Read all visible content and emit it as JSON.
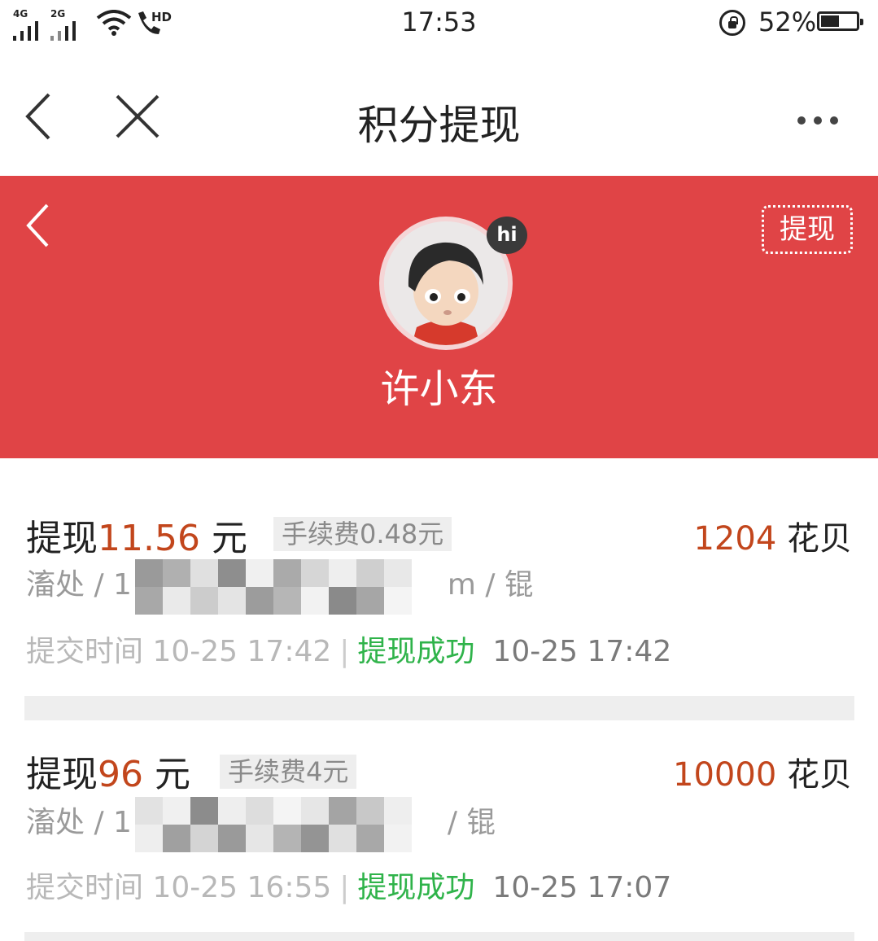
{
  "status_bar": {
    "network_1": "4G",
    "network_2": "2G",
    "time": "17:53",
    "battery_percent": "52%",
    "battery_level": 0.52,
    "icons": [
      "signal-icon",
      "wifi-icon",
      "hd-call-icon",
      "rotation-lock-icon",
      "battery-icon"
    ]
  },
  "nav": {
    "title": "积分提现"
  },
  "profile": {
    "username": "许小东",
    "badge": "hi",
    "withdraw_button": "提现"
  },
  "records": [
    {
      "amount_prefix": "提现",
      "amount": "11.56",
      "amount_unit": " 元",
      "fee": "手续费0.48元",
      "points_value": "1204",
      "points_unit": " 花贝",
      "account_prefix": "滀处 / 1",
      "account_suffix": "m / 锟",
      "submitted_label": "提交时间",
      "submitted_time": "10-25 17:42",
      "status": "提现成功",
      "status_time": "10-25 17:42"
    },
    {
      "amount_prefix": "提现",
      "amount": "96",
      "amount_unit": " 元",
      "fee": "手续费4元",
      "points_value": "10000",
      "points_unit": " 花贝",
      "account_prefix": "滀处 / 1",
      "account_suffix": "/ 锟",
      "submitted_label": "提交时间",
      "submitted_time": "10-25 16:55",
      "status": "提现成功",
      "status_time": "10-25 17:07"
    }
  ],
  "colors": {
    "header_red": "#e04446",
    "amount_orange": "#c2461c",
    "success_green": "#2fb34a"
  }
}
